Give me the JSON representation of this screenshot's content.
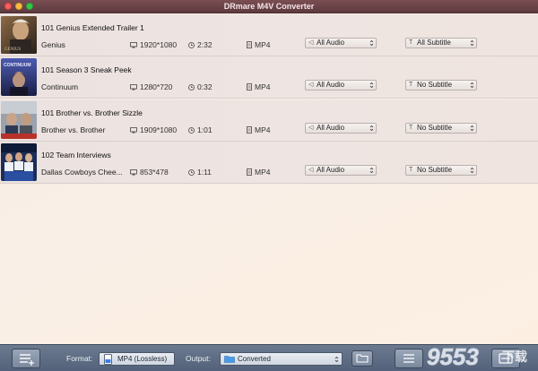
{
  "app": {
    "title": "DRmare M4V Converter"
  },
  "rows": [
    {
      "title": "101 Genius Extended Trailer  1",
      "subtitle": "Genius",
      "resolution": "1920*1080",
      "duration": "2:32",
      "format": "MP4",
      "audio": "All Audio",
      "subtitle_track": "All Subtitle",
      "thumb_color": "#7a5a3a"
    },
    {
      "title": "101 Season 3 Sneak Peek",
      "subtitle": "Continuum",
      "resolution": "1280*720",
      "duration": "0:32",
      "format": "MP4",
      "audio": "All Audio",
      "subtitle_track": "No Subtitle",
      "thumb_color": "#3a3e7a",
      "thumb_text": "CONTINUUM"
    },
    {
      "title": "101 Brother vs. Brother Sizzle",
      "subtitle": "Brother vs. Brother",
      "resolution": "1909*1080",
      "duration": "1:01",
      "format": "MP4",
      "audio": "All Audio",
      "subtitle_track": "No Subtitle",
      "thumb_color": "#6a6f78"
    },
    {
      "title": "102 Team Interviews",
      "subtitle": "Dallas Cowboys Chee...",
      "resolution": "853*478",
      "duration": "1:11",
      "format": "MP4",
      "audio": "All Audio",
      "subtitle_track": "No Subtitle",
      "thumb_color": "#2b3f6e"
    }
  ],
  "bottom": {
    "format_label": "Format:",
    "format_value": "MP4 (Lossless)",
    "output_label": "Output:",
    "output_value": "Converted"
  },
  "watermark": {
    "text": "9553",
    "suffix": "下载"
  },
  "colors": {
    "titlebar": "#5d3a3f",
    "bottombar": "#5f6e84",
    "accent_folder": "#4a9ae8"
  }
}
